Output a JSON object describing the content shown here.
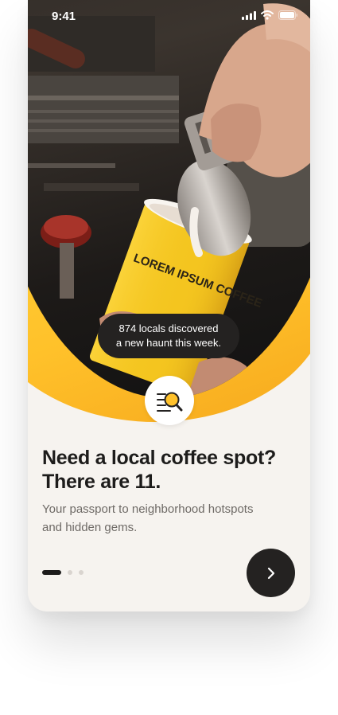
{
  "status_bar": {
    "time": "9:41"
  },
  "hero": {
    "cup_text": "LOREM IPSUM COFFEE",
    "toast_line1": "874 locals discovered",
    "toast_line2": "a new haunt this week."
  },
  "badge": {
    "icon": "list-search-icon"
  },
  "content": {
    "headline_line1": "Need a local coffee spot?",
    "headline_line2": "There are 11.",
    "subhead_line1": "Your passport to neighborhood hotspots",
    "subhead_line2": "and hidden gems."
  },
  "pager": {
    "total": 3,
    "active": 1
  },
  "next_button": {
    "icon": "chevron-right-icon"
  },
  "colors": {
    "accent_yellow": "#ffc12a",
    "dark": "#242221",
    "background": "#f6f3ef",
    "body_text": "#6e6a66"
  }
}
